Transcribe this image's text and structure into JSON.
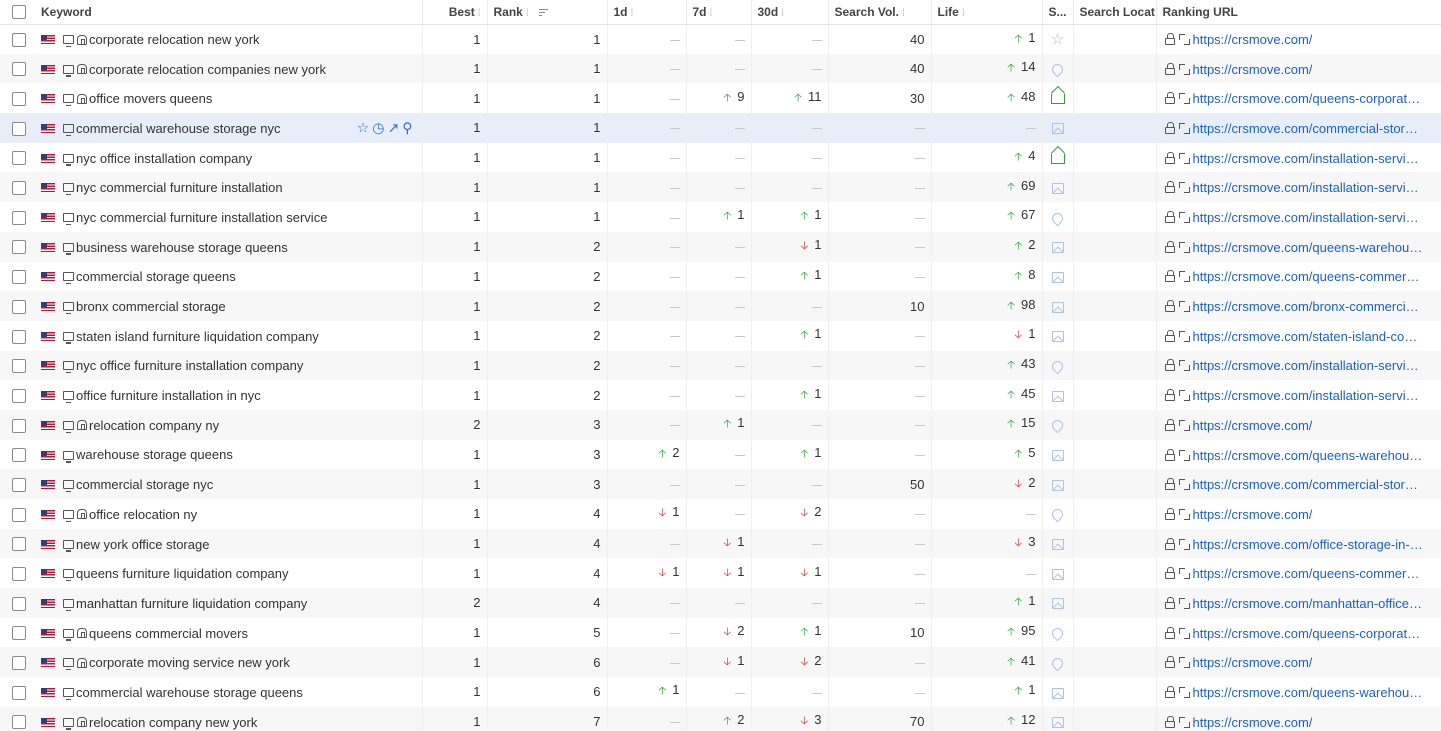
{
  "header": {
    "keyword": "Keyword",
    "best": "Best",
    "rank": "Rank",
    "d1": "1d",
    "d7": "7d",
    "d30": "30d",
    "search_vol": "Search Vol.",
    "life": "Life",
    "serp": "S...",
    "search_location": "Search Locat",
    "ranking_url": "Ranking URL",
    "sort_indicator": "⁞"
  },
  "colors": {
    "up": "#22a22a",
    "down": "#d93025",
    "link": "#1a5fd0",
    "hover_row": "#e8eef7"
  },
  "rows": [
    {
      "keyword": "corporate relocation new york",
      "local": true,
      "best": "1",
      "rank": "1",
      "d1": null,
      "d7": null,
      "d30": null,
      "vol": "40",
      "life": {
        "dir": "up",
        "val": "1"
      },
      "serp": "star-icon",
      "url": "https://crsmove.com/"
    },
    {
      "keyword": "corporate relocation companies new york",
      "local": true,
      "best": "1",
      "rank": "1",
      "d1": null,
      "d7": null,
      "d30": null,
      "vol": "40",
      "life": {
        "dir": "up",
        "val": "14"
      },
      "serp": "pin-icon",
      "url": "https://crsmove.com/"
    },
    {
      "keyword": "office movers queens",
      "local": true,
      "best": "1",
      "rank": "1",
      "d1": null,
      "d7": {
        "dir": "up",
        "val": "9"
      },
      "d30": {
        "dir": "up",
        "val": "11"
      },
      "vol": "30",
      "life": {
        "dir": "up",
        "val": "48"
      },
      "serp": "crown-icon",
      "url": "https://crsmove.com/queens-corporate-..."
    },
    {
      "keyword": "commercial warehouse storage nyc",
      "local": false,
      "hovered": true,
      "best": "1",
      "rank": "1",
      "d1": null,
      "d7": null,
      "d30": null,
      "vol": null,
      "life": null,
      "serp": "image-icon",
      "url": "https://crsmove.com/commercial-storag..."
    },
    {
      "keyword": "nyc office installation company",
      "local": false,
      "best": "1",
      "rank": "1",
      "d1": null,
      "d7": null,
      "d30": null,
      "vol": null,
      "life": {
        "dir": "up",
        "val": "4"
      },
      "serp": "crown-icon",
      "url": "https://crsmove.com/installation-service..."
    },
    {
      "keyword": "nyc commercial furniture installation",
      "local": false,
      "best": "1",
      "rank": "1",
      "d1": null,
      "d7": null,
      "d30": null,
      "vol": null,
      "life": {
        "dir": "up",
        "val": "69"
      },
      "serp": "image-icon",
      "url": "https://crsmove.com/installation-service..."
    },
    {
      "keyword": "nyc commercial furniture installation service",
      "local": false,
      "best": "1",
      "rank": "1",
      "d1": null,
      "d7": {
        "dir": "up",
        "val": "1"
      },
      "d30": {
        "dir": "up",
        "val": "1"
      },
      "vol": null,
      "life": {
        "dir": "up",
        "val": "67"
      },
      "serp": "pin-icon",
      "url": "https://crsmove.com/installation-service..."
    },
    {
      "keyword": "business warehouse storage queens",
      "local": false,
      "best": "1",
      "rank": "2",
      "d1": null,
      "d7": null,
      "d30": {
        "dir": "down",
        "val": "1"
      },
      "vol": null,
      "life": {
        "dir": "up",
        "val": "2"
      },
      "serp": "image-icon",
      "url": "https://crsmove.com/queens-warehouse..."
    },
    {
      "keyword": "commercial storage queens",
      "local": false,
      "best": "1",
      "rank": "2",
      "d1": null,
      "d7": null,
      "d30": {
        "dir": "up",
        "val": "1"
      },
      "vol": null,
      "life": {
        "dir": "up",
        "val": "8"
      },
      "serp": "image-icon",
      "url": "https://crsmove.com/queens-commerci..."
    },
    {
      "keyword": "bronx commercial storage",
      "local": false,
      "best": "1",
      "rank": "2",
      "d1": null,
      "d7": null,
      "d30": null,
      "vol": "10",
      "life": {
        "dir": "up",
        "val": "98"
      },
      "serp": "image-icon",
      "url": "https://crsmove.com/bronx-commercial..."
    },
    {
      "keyword": "staten island furniture liquidation company",
      "local": false,
      "best": "1",
      "rank": "2",
      "d1": null,
      "d7": null,
      "d30": {
        "dir": "up",
        "val": "1"
      },
      "vol": null,
      "life": {
        "dir": "down",
        "val": "1"
      },
      "serp": "image-icon",
      "url": "https://crsmove.com/staten-island-com..."
    },
    {
      "keyword": "nyc office furniture installation company",
      "local": false,
      "best": "1",
      "rank": "2",
      "d1": null,
      "d7": null,
      "d30": null,
      "vol": null,
      "life": {
        "dir": "up",
        "val": "43"
      },
      "serp": "pin-icon",
      "url": "https://crsmove.com/installation-service..."
    },
    {
      "keyword": "office furniture installation in nyc",
      "local": false,
      "best": "1",
      "rank": "2",
      "d1": null,
      "d7": null,
      "d30": {
        "dir": "up",
        "val": "1"
      },
      "vol": null,
      "life": {
        "dir": "up",
        "val": "45"
      },
      "serp": "image-icon",
      "url": "https://crsmove.com/installation-service..."
    },
    {
      "keyword": "relocation company ny",
      "local": true,
      "best": "2",
      "rank": "3",
      "d1": null,
      "d7": {
        "dir": "up",
        "val": "1"
      },
      "d30": null,
      "vol": null,
      "life": {
        "dir": "up",
        "val": "15"
      },
      "serp": "pin-icon",
      "url": "https://crsmove.com/"
    },
    {
      "keyword": "warehouse storage queens",
      "local": false,
      "best": "1",
      "rank": "3",
      "d1": {
        "dir": "up",
        "val": "2"
      },
      "d7": null,
      "d30": {
        "dir": "up",
        "val": "1"
      },
      "vol": null,
      "life": {
        "dir": "up",
        "val": "5"
      },
      "serp": "image-icon",
      "url": "https://crsmove.com/queens-warehouse..."
    },
    {
      "keyword": "commercial storage nyc",
      "local": false,
      "best": "1",
      "rank": "3",
      "d1": null,
      "d7": null,
      "d30": null,
      "vol": "50",
      "life": {
        "dir": "down",
        "val": "2"
      },
      "serp": "image-icon",
      "url": "https://crsmove.com/commercial-storag..."
    },
    {
      "keyword": "office relocation ny",
      "local": true,
      "best": "1",
      "rank": "4",
      "d1": {
        "dir": "down",
        "val": "1"
      },
      "d7": null,
      "d30": {
        "dir": "down",
        "val": "2"
      },
      "vol": null,
      "life": null,
      "serp": "pin-icon",
      "url": "https://crsmove.com/"
    },
    {
      "keyword": "new york office storage",
      "local": false,
      "best": "1",
      "rank": "4",
      "d1": null,
      "d7": {
        "dir": "down",
        "val": "1"
      },
      "d30": null,
      "vol": null,
      "life": {
        "dir": "down",
        "val": "3"
      },
      "serp": "image-icon",
      "url": "https://crsmove.com/office-storage-in-n..."
    },
    {
      "keyword": "queens furniture liquidation company",
      "local": false,
      "best": "1",
      "rank": "4",
      "d1": {
        "dir": "down",
        "val": "1"
      },
      "d7": {
        "dir": "down",
        "val": "1"
      },
      "d30": {
        "dir": "down",
        "val": "1"
      },
      "vol": null,
      "life": null,
      "serp": "image-icon",
      "url": "https://crsmove.com/queens-commerci..."
    },
    {
      "keyword": "manhattan furniture liquidation company",
      "local": false,
      "best": "2",
      "rank": "4",
      "d1": null,
      "d7": null,
      "d30": null,
      "vol": null,
      "life": {
        "dir": "up",
        "val": "1"
      },
      "serp": "image-icon",
      "url": "https://crsmove.com/manhattan-office-f..."
    },
    {
      "keyword": "queens commercial movers",
      "local": true,
      "best": "1",
      "rank": "5",
      "d1": null,
      "d7": {
        "dir": "down",
        "val": "2"
      },
      "d30": {
        "dir": "up",
        "val": "1"
      },
      "vol": "10",
      "life": {
        "dir": "up",
        "val": "95"
      },
      "serp": "pin-icon",
      "url": "https://crsmove.com/queens-corporate-..."
    },
    {
      "keyword": "corporate moving service new york",
      "local": true,
      "best": "1",
      "rank": "6",
      "d1": null,
      "d7": {
        "dir": "down",
        "val": "1"
      },
      "d30": {
        "dir": "down",
        "val": "2"
      },
      "vol": null,
      "life": {
        "dir": "up",
        "val": "41"
      },
      "serp": "pin-icon",
      "url": "https://crsmove.com/"
    },
    {
      "keyword": "commercial warehouse storage queens",
      "local": false,
      "best": "1",
      "rank": "6",
      "d1": {
        "dir": "up",
        "val": "1"
      },
      "d7": null,
      "d30": null,
      "vol": null,
      "life": {
        "dir": "up",
        "val": "1"
      },
      "serp": "image-icon",
      "url": "https://crsmove.com/queens-warehouse..."
    },
    {
      "keyword": "relocation company new york",
      "local": true,
      "best": "1",
      "rank": "7",
      "d1": null,
      "d7": {
        "dir": "up",
        "val": "2"
      },
      "d30": {
        "dir": "down",
        "val": "3"
      },
      "vol": "70",
      "life": {
        "dir": "up",
        "val": "12"
      },
      "serp": "image-icon",
      "url": "https://crsmove.com/"
    }
  ]
}
